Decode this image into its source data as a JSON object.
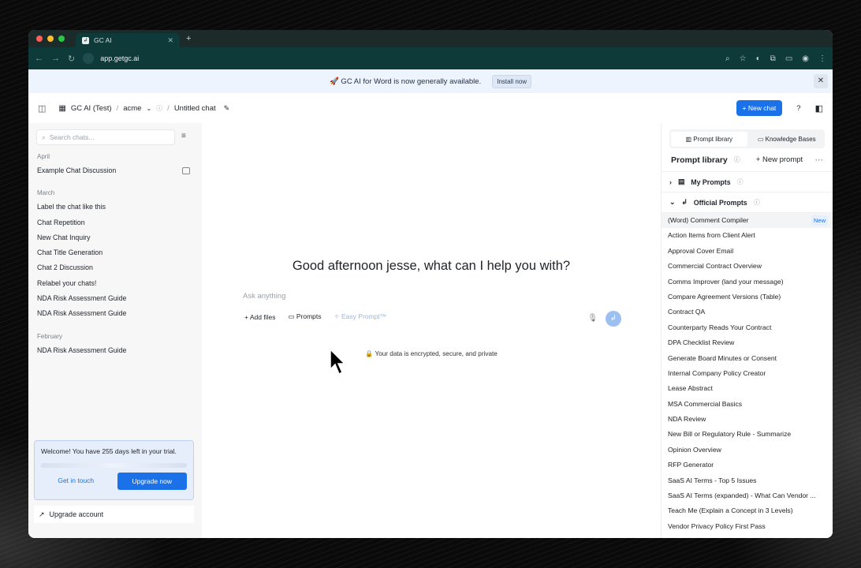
{
  "browser": {
    "tab_title": "GC AI",
    "url": "app.getgc.ai"
  },
  "banner": {
    "text": "🚀 GC AI for Word is now generally available.",
    "install_label": "Install now"
  },
  "topbar": {
    "workspace": "GC AI (Test)",
    "org": "acme",
    "chat_title": "Untitled chat",
    "new_chat_label": "New chat",
    "help_label": "?"
  },
  "sidebar": {
    "search_placeholder": "Search chats...",
    "sections": [
      {
        "label": "April",
        "items": [
          "Example Chat Discussion"
        ]
      },
      {
        "label": "March",
        "items": [
          "Label the chat like this",
          "Chat Repetition",
          "New Chat Inquiry",
          "Chat Title Generation",
          "Chat 2 Discussion",
          "Relabel your chats!",
          "NDA Risk Assessment Guide",
          "NDA Risk Assessment Guide"
        ]
      },
      {
        "label": "February",
        "items": [
          "NDA Risk Assessment Guide"
        ]
      }
    ],
    "trial": {
      "text": "Welcome! You have 255 days left in your trial.",
      "contact_label": "Get in touch",
      "upgrade_label": "Upgrade now"
    },
    "upgrade_account": "Upgrade account"
  },
  "main": {
    "greeting": "Good afternoon jesse, what can I help you with?",
    "ask_placeholder": "Ask anything",
    "add_files": "Add files",
    "prompts": "Prompts",
    "easy_prompt": "Easy Prompt™",
    "secure_note": "Your data is encrypted, secure, and private"
  },
  "right_panel": {
    "tab_prompt_library": "Prompt library",
    "tab_knowledge": "Knowledge Bases",
    "title": "Prompt library",
    "new_prompt": "New prompt",
    "my_prompts": "My Prompts",
    "official_prompts": "Official Prompts",
    "new_badge": "New",
    "prompts": [
      "(Word) Comment Compiler",
      "Action Items from Client Alert",
      "Approval Cover Email",
      "Commercial Contract Overview",
      "Comms Improver (land your message)",
      "Compare Agreement Versions (Table)",
      "Contract QA",
      "Counterparty Reads Your Contract",
      "DPA Checklist Review",
      "Generate Board Minutes or Consent",
      "Internal Company Policy Creator",
      "Lease Abstract",
      "MSA Commercial Basics",
      "NDA Review",
      "New Bill or Regulatory Rule - Summarize",
      "Opinion Overview",
      "RFP Generator",
      "SaaS AI Terms - Top 5 Issues",
      "SaaS AI Terms (expanded) - What Can Vendor ...",
      "Teach Me (Explain a Concept in 3 Levels)",
      "Vendor Privacy Policy First Pass"
    ]
  },
  "colors": {
    "accent": "#1b72e8",
    "chrome": "#0f3a3a"
  }
}
